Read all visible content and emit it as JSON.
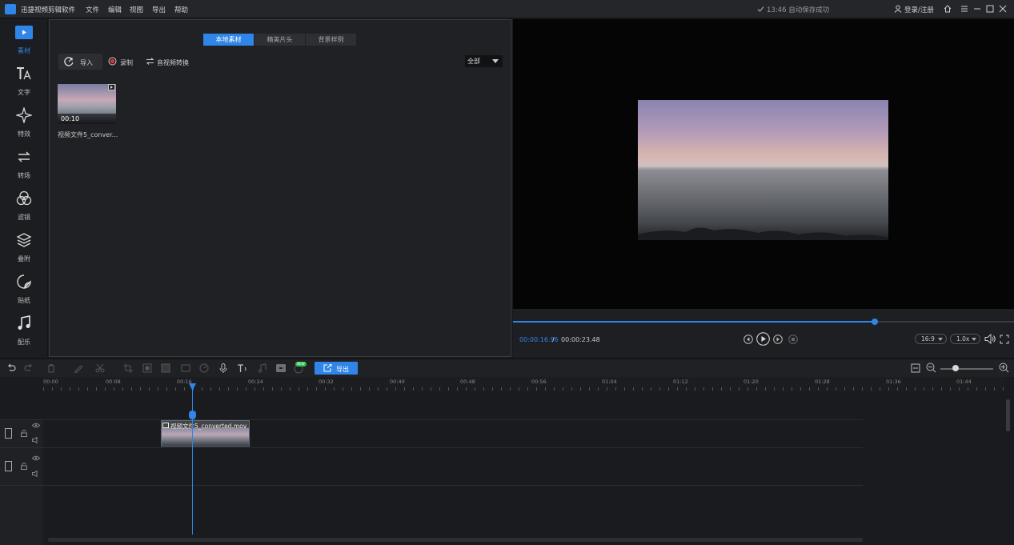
{
  "app": {
    "title": "迅捷视频剪辑软件",
    "menu": [
      "文件",
      "编辑",
      "视图",
      "导出",
      "帮助"
    ],
    "autosave": "13:46 自动保存成功",
    "login": "登录/注册"
  },
  "nav": [
    {
      "label": "素材",
      "icon": "play-square-icon",
      "active": true
    },
    {
      "label": "文字",
      "icon": "text-icon"
    },
    {
      "label": "特效",
      "icon": "sparkle-icon"
    },
    {
      "label": "转场",
      "icon": "transition-icon"
    },
    {
      "label": "滤镜",
      "icon": "filter-circles-icon"
    },
    {
      "label": "叠附",
      "icon": "layers-icon"
    },
    {
      "label": "贴纸",
      "icon": "sticker-icon"
    },
    {
      "label": "配乐",
      "icon": "music-note-icon"
    }
  ],
  "material": {
    "tabs": [
      "本地素材",
      "精美片头",
      "背景样例"
    ],
    "import": "导入",
    "record": "录制",
    "convert": "音视频转换",
    "filter": "全部",
    "item": {
      "duration": "00:10",
      "name": "视频文件5_conver..."
    }
  },
  "preview": {
    "time_current": "00:00:16.96",
    "time_sep": " / ",
    "time_total": "00:00:23.48",
    "progress": 0.722,
    "aspect": "16:9",
    "speed": "1.0x"
  },
  "toolbar": {
    "export": "导出",
    "new_badge": "NEW"
  },
  "timeline": {
    "ticks": [
      "00:00",
      "00:08",
      "00:16",
      "00:24",
      "00:32",
      "00:40",
      "00:48",
      "00:56",
      "01:04",
      "01:12",
      "01:20",
      "01:28",
      "01:36",
      "01:44"
    ],
    "clip_name": "视频文件5_converted.mov"
  },
  "colors": {
    "accent": "#2f86e8",
    "panel": "#202124",
    "background": "#1a1b1e"
  }
}
